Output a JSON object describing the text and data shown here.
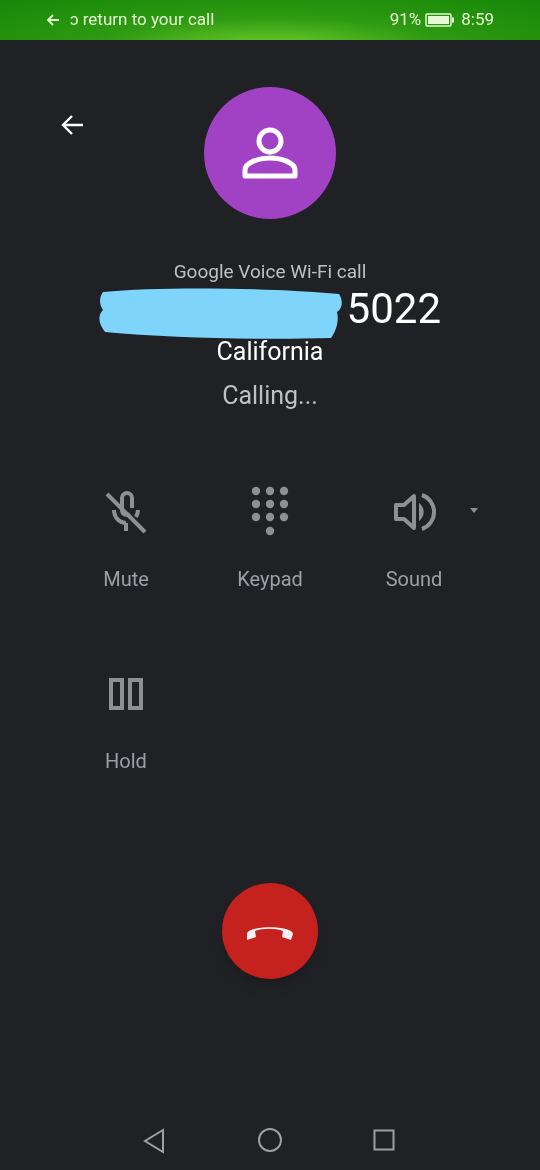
{
  "status_bar": {
    "return_text": "ɔ return to your call",
    "battery": "91%",
    "time": "8:59"
  },
  "call": {
    "caption": "Google Voice Wi-Fi call",
    "number": "5022",
    "number_redacted": true,
    "location": "California",
    "status": "Calling..."
  },
  "controls": [
    {
      "kind": "mute",
      "label": "Mute"
    },
    {
      "kind": "keypad",
      "label": "Keypad"
    },
    {
      "kind": "sound",
      "label": "Sound"
    },
    {
      "kind": "hold",
      "label": "Hold"
    }
  ]
}
